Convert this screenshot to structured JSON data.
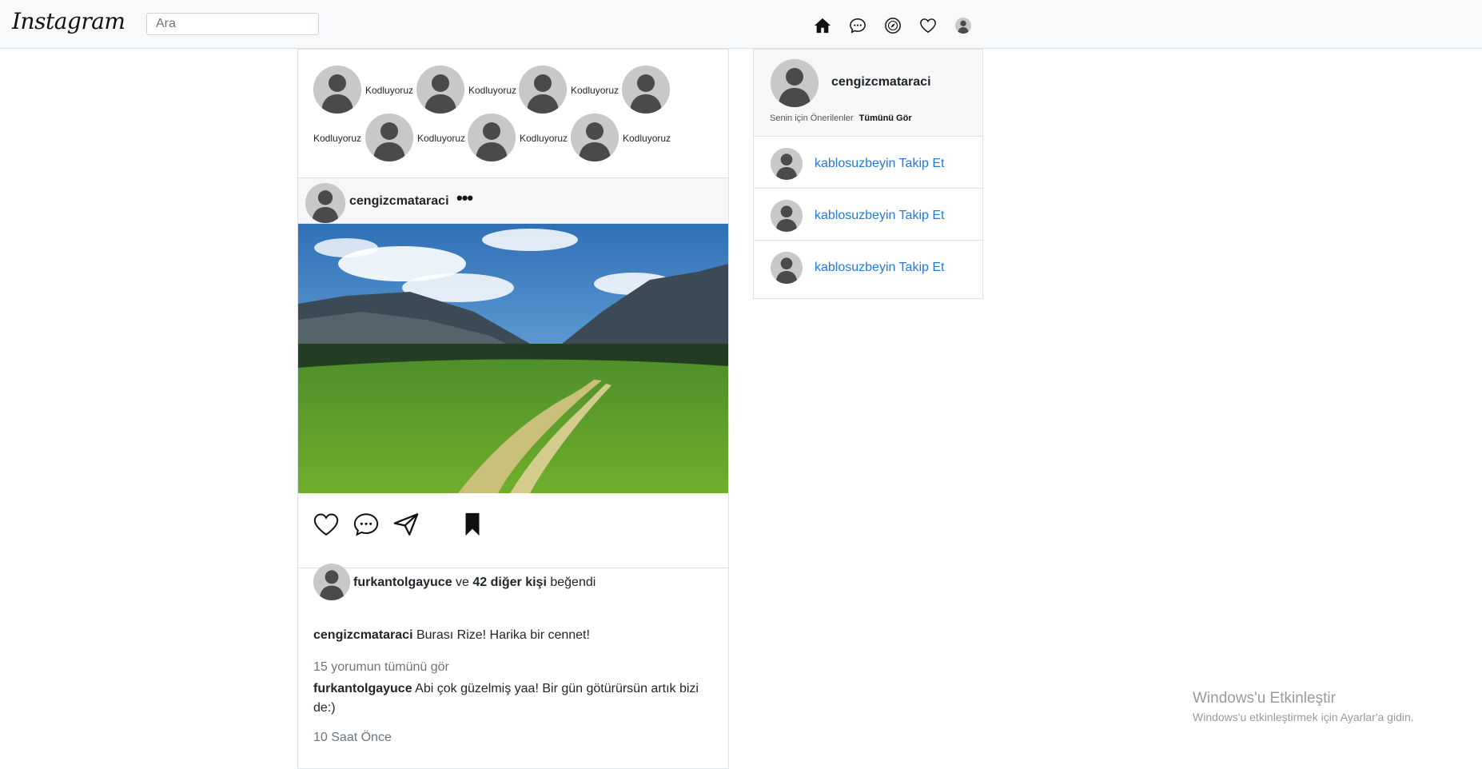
{
  "nav": {
    "logo": "Instagram",
    "search_placeholder": "Ara",
    "icons": [
      "home-icon",
      "messages-icon",
      "explore-icon",
      "heart-icon",
      "profile-avatar-icon"
    ]
  },
  "stories": {
    "items": [
      {
        "label": "Kodluyoruz"
      },
      {
        "label": "Kodluyoruz"
      },
      {
        "label": "Kodluyoruz"
      },
      {
        "label": "Kodluyoruz"
      },
      {
        "label": "Kodluyoruz"
      },
      {
        "label": "Kodluyoruz"
      },
      {
        "label": "Kodluyoruz"
      }
    ]
  },
  "post": {
    "username": "cengizcmataraci",
    "more": "•••",
    "actions": [
      "heart-icon",
      "comment-icon",
      "send-icon",
      "bookmark-icon"
    ],
    "likes": {
      "user": "furkantolgayuce",
      "connector": "ve",
      "others": "42 diğer kişi",
      "suffix": "beğendi"
    },
    "caption": {
      "user": "cengizcmataraci",
      "text": "Burası Rize! Harika bir cennet!"
    },
    "view_comments": "15 yorumun tümünü gör",
    "comment": {
      "user": "furkantolgayuce",
      "text": "Abi çok güzelmiş yaa! Bir gün götürürsün artık bizi de:)"
    },
    "time": "10 Saat Önce"
  },
  "sidebar": {
    "username": "cengizcmataraci",
    "suggestions_label": "Senin için Önerilenler",
    "see_all": "Tümünü Gör",
    "suggestions": [
      {
        "text": "kablosuzbeyin Takip Et"
      },
      {
        "text": "kablosuzbeyin Takip Et"
      },
      {
        "text": "kablosuzbeyin Takip Et"
      }
    ]
  },
  "watermark": {
    "title": "Windows'u Etkinleştir",
    "subtitle": "Windows'u etkinleştirmek için Ayarlar'a gidin."
  }
}
